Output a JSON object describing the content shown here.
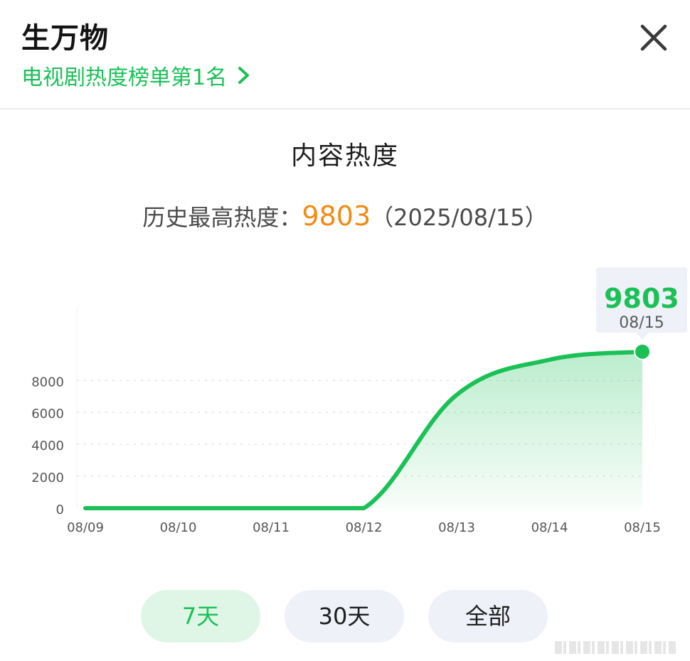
{
  "header": {
    "title": "生万物",
    "rank_link": "电视剧热度榜单第1名"
  },
  "section": {
    "title": "内容热度",
    "peak_label": "历史最高热度：",
    "peak_value": "9803",
    "peak_date": "（2025/08/15）"
  },
  "tooltip": {
    "value": "9803",
    "date": "08/15"
  },
  "range_buttons": [
    "7天",
    "30天",
    "全部"
  ],
  "colors": {
    "accent": "#1bc157",
    "peak": "#f28a12",
    "button_bg": "#eef1f8",
    "button_active_bg": "#dff6e6"
  },
  "chart_data": {
    "type": "area",
    "x": [
      "08/09",
      "08/10",
      "08/11",
      "08/12",
      "08/13",
      "08/14",
      "08/15"
    ],
    "series": [
      {
        "values": [
          0,
          0,
          0,
          0,
          7100,
          9300,
          9803
        ]
      }
    ],
    "yticks": [
      0,
      2000,
      4000,
      6000,
      8000
    ],
    "ylim": [
      0,
      12600
    ],
    "grid": true,
    "highlight_point": {
      "x": "08/15",
      "y": 9803
    }
  }
}
